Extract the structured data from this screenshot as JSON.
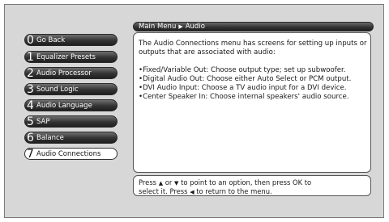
{
  "menu": {
    "items": [
      {
        "number": "0",
        "label": "Go Back"
      },
      {
        "number": "1",
        "label": "Equalizer Presets"
      },
      {
        "number": "2",
        "label": "Audio Processor"
      },
      {
        "number": "3",
        "label": "Sound Logic"
      },
      {
        "number": "4",
        "label": "Audio Language"
      },
      {
        "number": "5",
        "label": "SAP"
      },
      {
        "number": "6",
        "label": "Balance"
      },
      {
        "number": "7",
        "label": "Audio Connections"
      }
    ],
    "selected_index": 7
  },
  "breadcrumb": {
    "parent": "Main Menu",
    "current": "Audio"
  },
  "content": {
    "intro": "The Audio Connections menu has screens for setting up inputs or outputs that are associated with audio:",
    "bullets": [
      "•Fixed/Variable Out: Choose output type; set up subwoofer.",
      "•Digital Audio Out: Choose either Auto Select or PCM output.",
      "•DVI Audio Input: Choose a TV audio input for a DVI device.",
      "•Center Speaker In: Choose internal speakers' audio source."
    ]
  },
  "hint": {
    "line1_a": "Press",
    "line1_b": "or",
    "line1_c": "to point to an option, then press OK to",
    "line2_a": "select it. Press",
    "line2_b": "to return to the menu."
  },
  "icons": {
    "up": "arrow-up-icon",
    "down": "arrow-down-icon",
    "left": "arrow-left-icon",
    "breadcrumb_sep": "breadcrumb-chevron-icon"
  },
  "colors": {
    "panel_bg": "#d7d7d7",
    "button_dark": "#333333",
    "button_selected": "#ffffff"
  }
}
